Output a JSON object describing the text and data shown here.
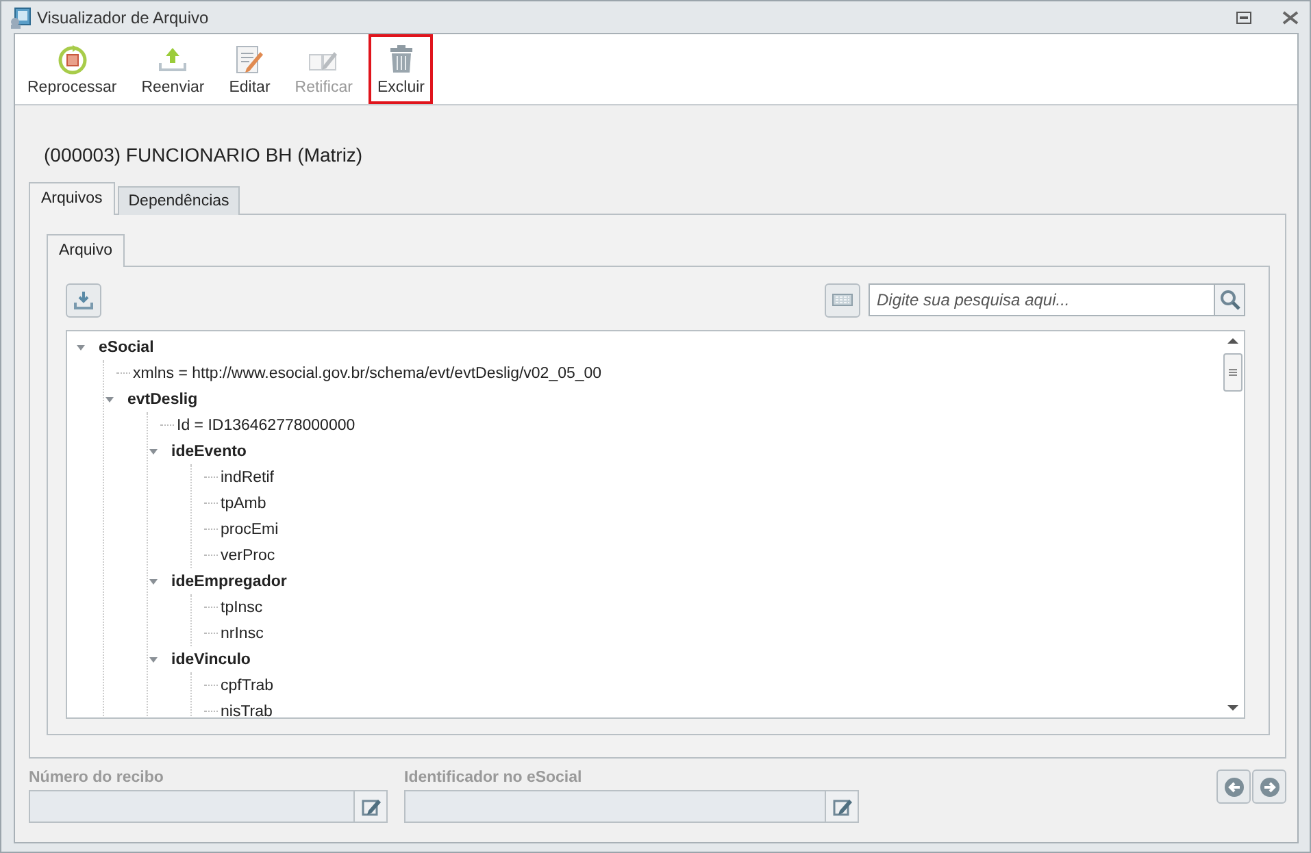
{
  "window": {
    "title": "Visualizador de Arquivo"
  },
  "toolbar": [
    {
      "label": "Reprocessar",
      "kind": "reprocess",
      "disabled": false,
      "highlighted": false
    },
    {
      "label": "Reenviar",
      "kind": "upload",
      "disabled": false,
      "highlighted": false
    },
    {
      "label": "Editar",
      "kind": "edit",
      "disabled": false,
      "highlighted": false
    },
    {
      "label": "Retificar",
      "kind": "rectify",
      "disabled": true,
      "highlighted": false
    },
    {
      "label": "Excluir",
      "kind": "delete",
      "disabled": false,
      "highlighted": true
    }
  ],
  "heading": "(000003) FUNCIONARIO BH (Matriz)",
  "tabs": [
    {
      "label": "Arquivos",
      "selected": true
    },
    {
      "label": "Dependências",
      "selected": false
    }
  ],
  "inner_tabs": [
    {
      "label": "Arquivo",
      "selected": true
    }
  ],
  "search": {
    "placeholder": "Digite sua pesquisa aqui..."
  },
  "tree": [
    {
      "label": "eSocial",
      "kind": "element",
      "expanded": true,
      "children": [
        {
          "label": "xmlns = http://www.esocial.gov.br/schema/evt/evtDeslig/v02_05_00",
          "kind": "leaf"
        },
        {
          "label": "evtDeslig",
          "kind": "element",
          "expanded": true,
          "children": [
            {
              "label": "Id = ID136462778000000",
              "kind": "leaf"
            },
            {
              "label": "ideEvento",
              "kind": "element",
              "expanded": true,
              "children": [
                {
                  "label": "indRetif",
                  "kind": "leaf"
                },
                {
                  "label": "tpAmb",
                  "kind": "leaf"
                },
                {
                  "label": "procEmi",
                  "kind": "leaf"
                },
                {
                  "label": "verProc",
                  "kind": "leaf"
                }
              ]
            },
            {
              "label": "ideEmpregador",
              "kind": "element",
              "expanded": true,
              "children": [
                {
                  "label": "tpInsc",
                  "kind": "leaf"
                },
                {
                  "label": "nrInsc",
                  "kind": "leaf"
                }
              ]
            },
            {
              "label": "ideVinculo",
              "kind": "element",
              "expanded": true,
              "children": [
                {
                  "label": "cpfTrab",
                  "kind": "leaf"
                },
                {
                  "label": "nisTrab",
                  "kind": "leaf"
                }
              ]
            }
          ]
        }
      ]
    }
  ],
  "fields": [
    {
      "label": "Número do recibo",
      "disabled": true
    },
    {
      "label": "Identificador no eSocial",
      "disabled": true
    }
  ]
}
